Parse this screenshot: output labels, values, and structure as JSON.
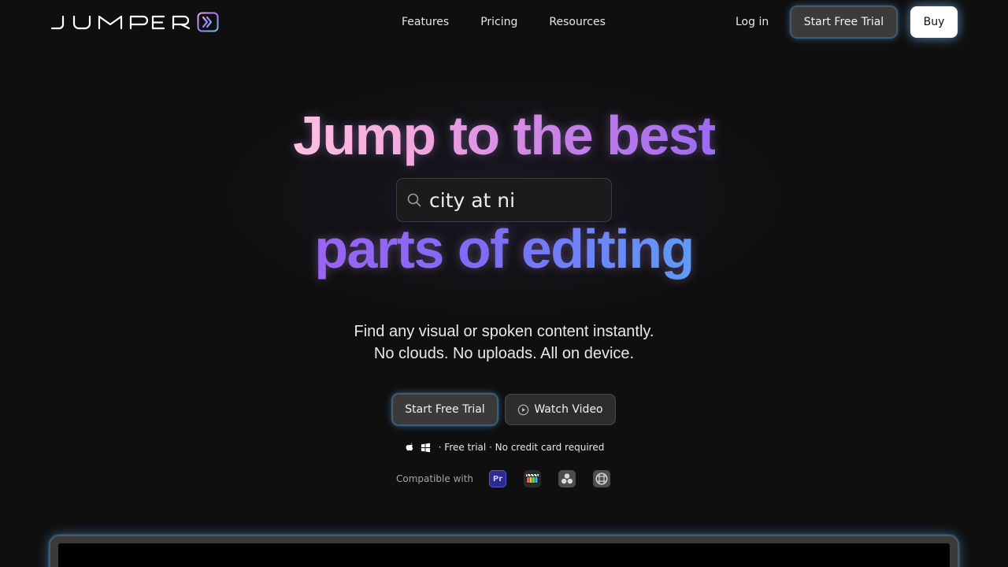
{
  "nav": {
    "brand": "JUMPER",
    "links": [
      "Features",
      "Pricing",
      "Resources"
    ],
    "login": "Log in",
    "trial": "Start Free Trial",
    "buy": "Buy"
  },
  "hero": {
    "line1": "Jump to the best",
    "line2": "parts of editing",
    "search_value": "city at ni",
    "sub1": "Find any visual or spoken content instantly.",
    "sub2": "No clouds. No uploads. All on device.",
    "cta_trial": "Start Free Trial",
    "cta_video": "Watch Video",
    "note": "· Free trial · No credit card required",
    "compat_label": "Compatible with",
    "compat_apps": [
      "Pr"
    ]
  },
  "colors": {
    "accent_glow": "#50aaff",
    "headline_pink": "#ffc1e0",
    "headline_purple": "#9b6bf2",
    "headline_blue": "#5e9bf5"
  },
  "icons": [
    "jumper-logo-icon",
    "search-icon",
    "play-circle-icon",
    "apple-icon",
    "windows-icon",
    "premiere-pro-icon",
    "final-cut-pro-icon",
    "davinci-resolve-icon",
    "avid-media-composer-icon"
  ]
}
